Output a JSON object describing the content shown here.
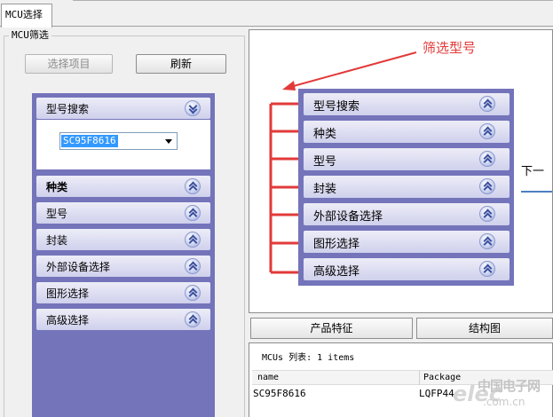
{
  "tab": {
    "label": "MCU选择"
  },
  "group": {
    "title": "MCU筛选"
  },
  "buttons": {
    "select_items": "选择项目",
    "refresh": "刷新"
  },
  "accordion": {
    "search": {
      "label": "型号搜索",
      "combo_value": "SC95F8616"
    },
    "items": [
      {
        "label": "种类"
      },
      {
        "label": "型号"
      },
      {
        "label": "封装"
      },
      {
        "label": "外部设备选择"
      },
      {
        "label": "图形选择"
      },
      {
        "label": "高级选择"
      }
    ]
  },
  "preview": {
    "annotation": "筛选型号",
    "items": [
      "型号搜索",
      "种类",
      "型号",
      "封装",
      "外部设备选择",
      "图形选择",
      "高级选择"
    ],
    "next_label": "下一",
    "colors": {
      "annotation": "#e23a3a",
      "accordion_bg": "#7474bb"
    }
  },
  "subtabs": {
    "features": "产品特征",
    "structure": "结构图"
  },
  "mcu_list": {
    "count_label": "MCUs 列表:  1 items",
    "columns": [
      "name",
      "Package"
    ],
    "rows": [
      {
        "name": "SC95F8616",
        "package": "LQFP44"
      }
    ]
  },
  "watermark": {
    "logo": "elec",
    "text": "中国电子网",
    "sub": ".com.cn"
  }
}
